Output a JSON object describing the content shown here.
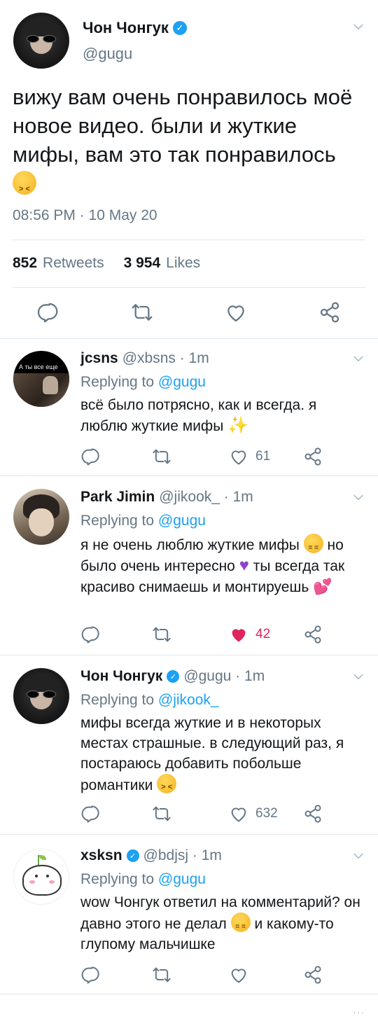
{
  "main_tweet": {
    "author_name": "Чон Чонгук",
    "verified_mark": "✓",
    "handle": "@gugu",
    "text": "вижу вам очень понравилось моё новое видео. были и жуткие мифы, вам это так понравилось",
    "timestamp": "08:56 PM · 10 May 20",
    "retweets_count": "852",
    "retweets_label": "Retweets",
    "likes_count": "3 954",
    "likes_label": "Likes"
  },
  "replies": [
    {
      "name": "jcsns",
      "verified": false,
      "handle": "@xbsns · 1m",
      "replying_prefix": "Replying to",
      "replying_to": "@gugu",
      "text": "всё было потрясно, как и всегда. я люблю жуткие мифы",
      "like_count": "61",
      "liked": false,
      "avatar_caption": "А ты все еще"
    },
    {
      "name": "Park Jimin",
      "verified": false,
      "handle": "@jikook_ · 1m",
      "replying_prefix": "Replying to",
      "replying_to": "@gugu",
      "text_part1": "я не очень люблю жуткие мифы",
      "text_part2": "но было очень интересно",
      "text_part3": "ты всегда так красиво снимаешь и монтируешь",
      "like_count": "42",
      "liked": true
    },
    {
      "name": "Чон Чонгук",
      "verified": true,
      "handle": "@gugu · 1m",
      "replying_prefix": "Replying to",
      "replying_to": "@jikook_",
      "text": "мифы всегда жуткие и в некоторых местах страшные. в следующий раз, я постараюсь добавить побольше романтики",
      "like_count": "632",
      "liked": false
    },
    {
      "name": "xsksn",
      "verified": true,
      "handle": "@bdjsj · 1m",
      "replying_prefix": "Replying to",
      "replying_to": "@gugu",
      "text_part1": "wow Чонгук ответил на комментарий? он давно этого не делал",
      "text_part2": "и какому-то глупому мальчишке",
      "like_count": "",
      "liked": false
    }
  ],
  "ellipsis": "...",
  "emoji": {
    "heart": "♥",
    "hearts": "💕",
    "sparkles": "✨"
  },
  "colors": {
    "accent": "#1da1f2",
    "like": "#e0245e",
    "secondary_text": "#657786",
    "divider": "#e1e8ed"
  },
  "icons": [
    "chevron-down-icon",
    "reply-icon",
    "retweet-icon",
    "like-icon",
    "share-icon",
    "verified-icon"
  ]
}
